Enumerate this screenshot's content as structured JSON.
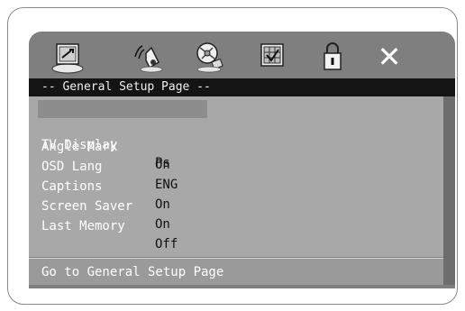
{
  "toolbar": {
    "icons": [
      "general-setup-icon",
      "audio-speaker-icon",
      "video-disc-icon",
      "preference-grid-icon",
      "lock-icon",
      "exit-icon"
    ],
    "exit_glyph": "✕"
  },
  "header": {
    "title": "-- General Setup Page --"
  },
  "settings": [
    {
      "label": "TV Display",
      "value": "Ps"
    },
    {
      "label": "Angle Mark",
      "value": "On"
    },
    {
      "label": "OSD Lang",
      "value": "ENG"
    },
    {
      "label": "Captions",
      "value": "On"
    },
    {
      "label": "Screen Saver",
      "value": "On"
    },
    {
      "label": "Last Memory",
      "value": "Off"
    }
  ],
  "status": {
    "text": "Go to General Setup Page"
  }
}
